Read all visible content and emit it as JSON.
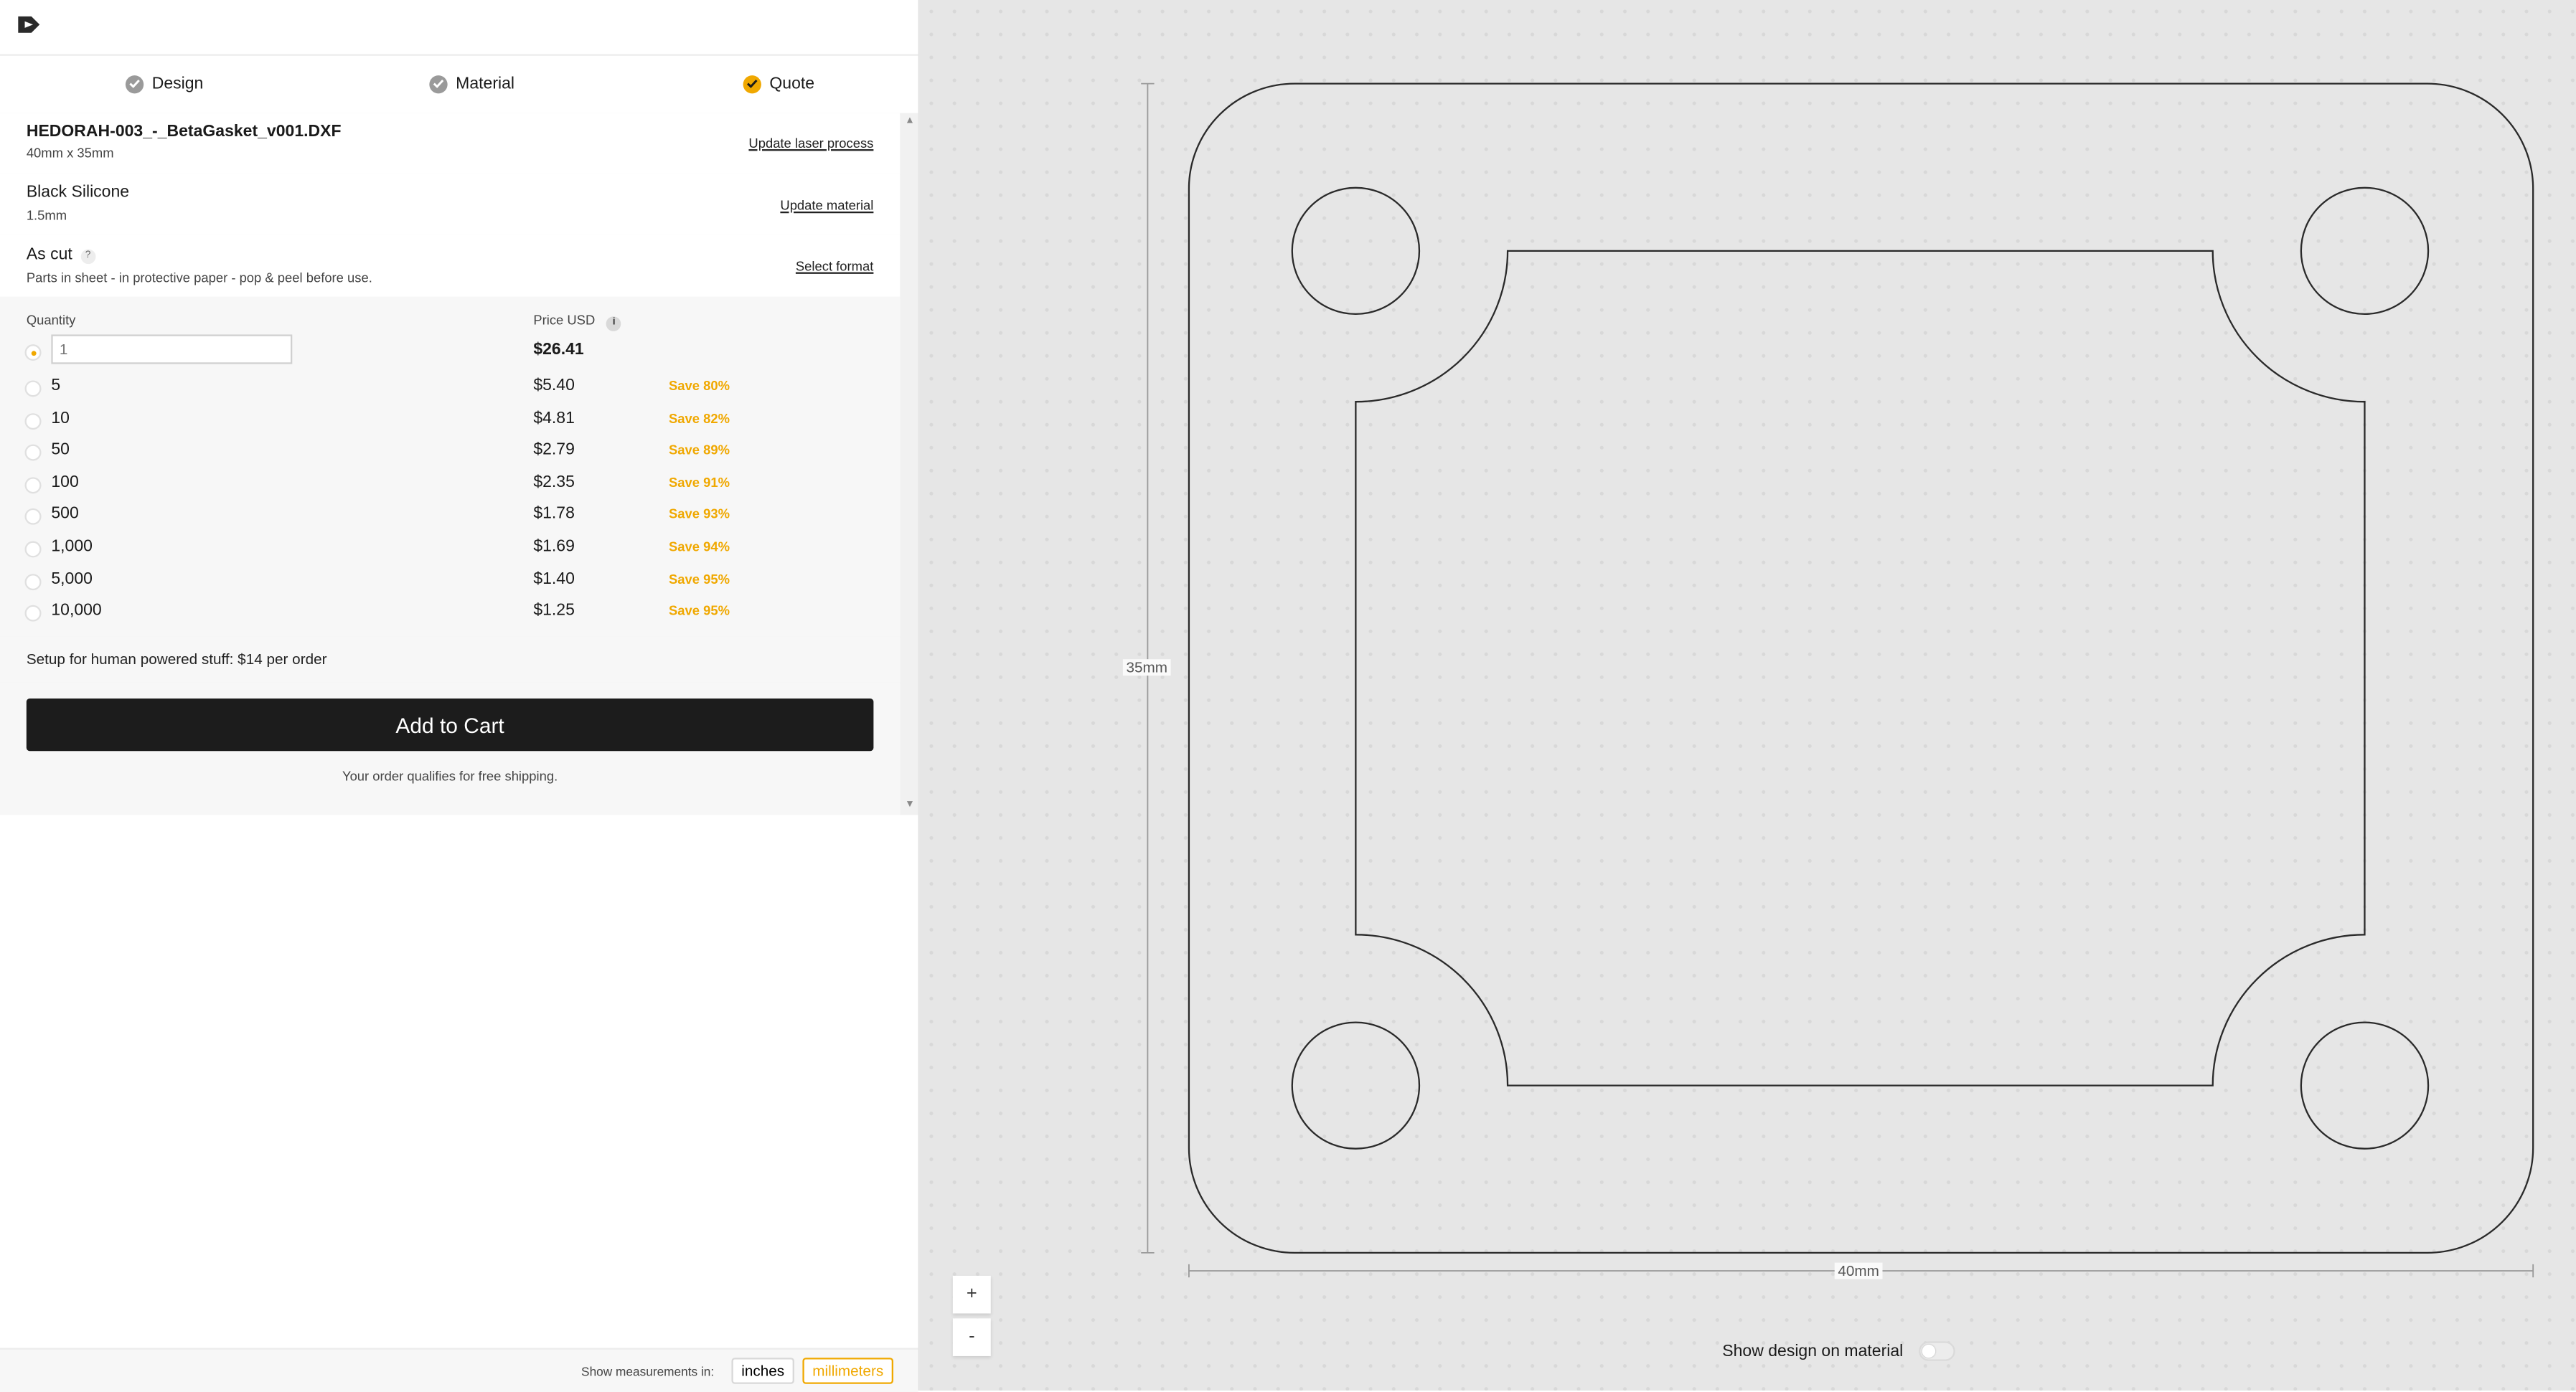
{
  "steps": [
    {
      "label": "Design",
      "state": "done"
    },
    {
      "label": "Material",
      "state": "done"
    },
    {
      "label": "Quote",
      "state": "current"
    }
  ],
  "file": {
    "name": "HEDORAH-003_-_BetaGasket_v001.DXF",
    "size": "40mm x 35mm",
    "link": "Update laser process"
  },
  "material": {
    "name": "Black Silicone",
    "thickness": "1.5mm",
    "link": "Update material"
  },
  "format": {
    "name": "As cut",
    "help": "?",
    "description": "Parts in sheet - in protective paper - pop & peel before use.",
    "link": "Select format"
  },
  "pricing": {
    "quantity_header": "Quantity",
    "price_header": "Price USD",
    "info": "i",
    "custom": {
      "placeholder": "1",
      "price": "$26.41",
      "selected": true
    },
    "tiers": [
      {
        "qty": "5",
        "price": "$5.40",
        "save": "Save 80%"
      },
      {
        "qty": "10",
        "price": "$4.81",
        "save": "Save 82%"
      },
      {
        "qty": "50",
        "price": "$2.79",
        "save": "Save 89%"
      },
      {
        "qty": "100",
        "price": "$2.35",
        "save": "Save 91%"
      },
      {
        "qty": "500",
        "price": "$1.78",
        "save": "Save 93%"
      },
      {
        "qty": "1,000",
        "price": "$1.69",
        "save": "Save 94%"
      },
      {
        "qty": "5,000",
        "price": "$1.40",
        "save": "Save 95%"
      },
      {
        "qty": "10,000",
        "price": "$1.25",
        "save": "Save 95%"
      }
    ]
  },
  "setup": "Setup for human powered stuff: $14 per order",
  "cart": {
    "button": "Add to Cart",
    "note": "Your order qualifies for free shipping."
  },
  "units": {
    "label": "Show measurements in:",
    "options": [
      "inches",
      "millimeters"
    ],
    "active": "millimeters"
  },
  "canvas": {
    "height_label": "35mm",
    "width_label": "40mm",
    "zoom_in": "+",
    "zoom_out": "-",
    "toggle_label": "Show design on material",
    "toggle_on": false
  },
  "colors": {
    "accent": "#f0a800",
    "button": "#1c1c1c"
  }
}
